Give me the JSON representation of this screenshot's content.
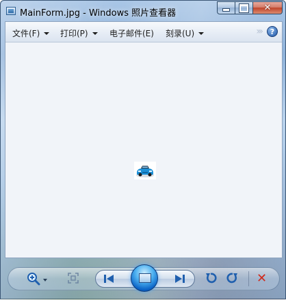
{
  "window": {
    "title": "MainForm.jpg - Windows 照片查看器",
    "icon": "photo-viewer-app-icon",
    "caption_buttons": [
      "minimize-icon",
      "maximize-icon",
      "close-icon"
    ]
  },
  "menubar": {
    "items": [
      {
        "label": "文件(F)",
        "has_dropdown": true
      },
      {
        "label": "打印(P)",
        "has_dropdown": true
      },
      {
        "label": "电子邮件(E)",
        "has_dropdown": false
      },
      {
        "label": "刻录(U)",
        "has_dropdown": true
      }
    ],
    "overflow_icon": "chevron-double-right-icon",
    "help_icon": "help-icon",
    "help_glyph": "?"
  },
  "viewer": {
    "image": "blue-car-thumbnail",
    "background": "#f1f4f9"
  },
  "toolbar": {
    "buttons": [
      "zoom-icon",
      "actual-size-icon",
      "previous-icon",
      "slideshow-icon",
      "next-icon",
      "rotate-left-icon",
      "rotate-right-icon",
      "delete-icon"
    ],
    "delete_glyph": "✕"
  },
  "colors": {
    "accent": "#0a62c6",
    "delete": "#d02a1c"
  }
}
